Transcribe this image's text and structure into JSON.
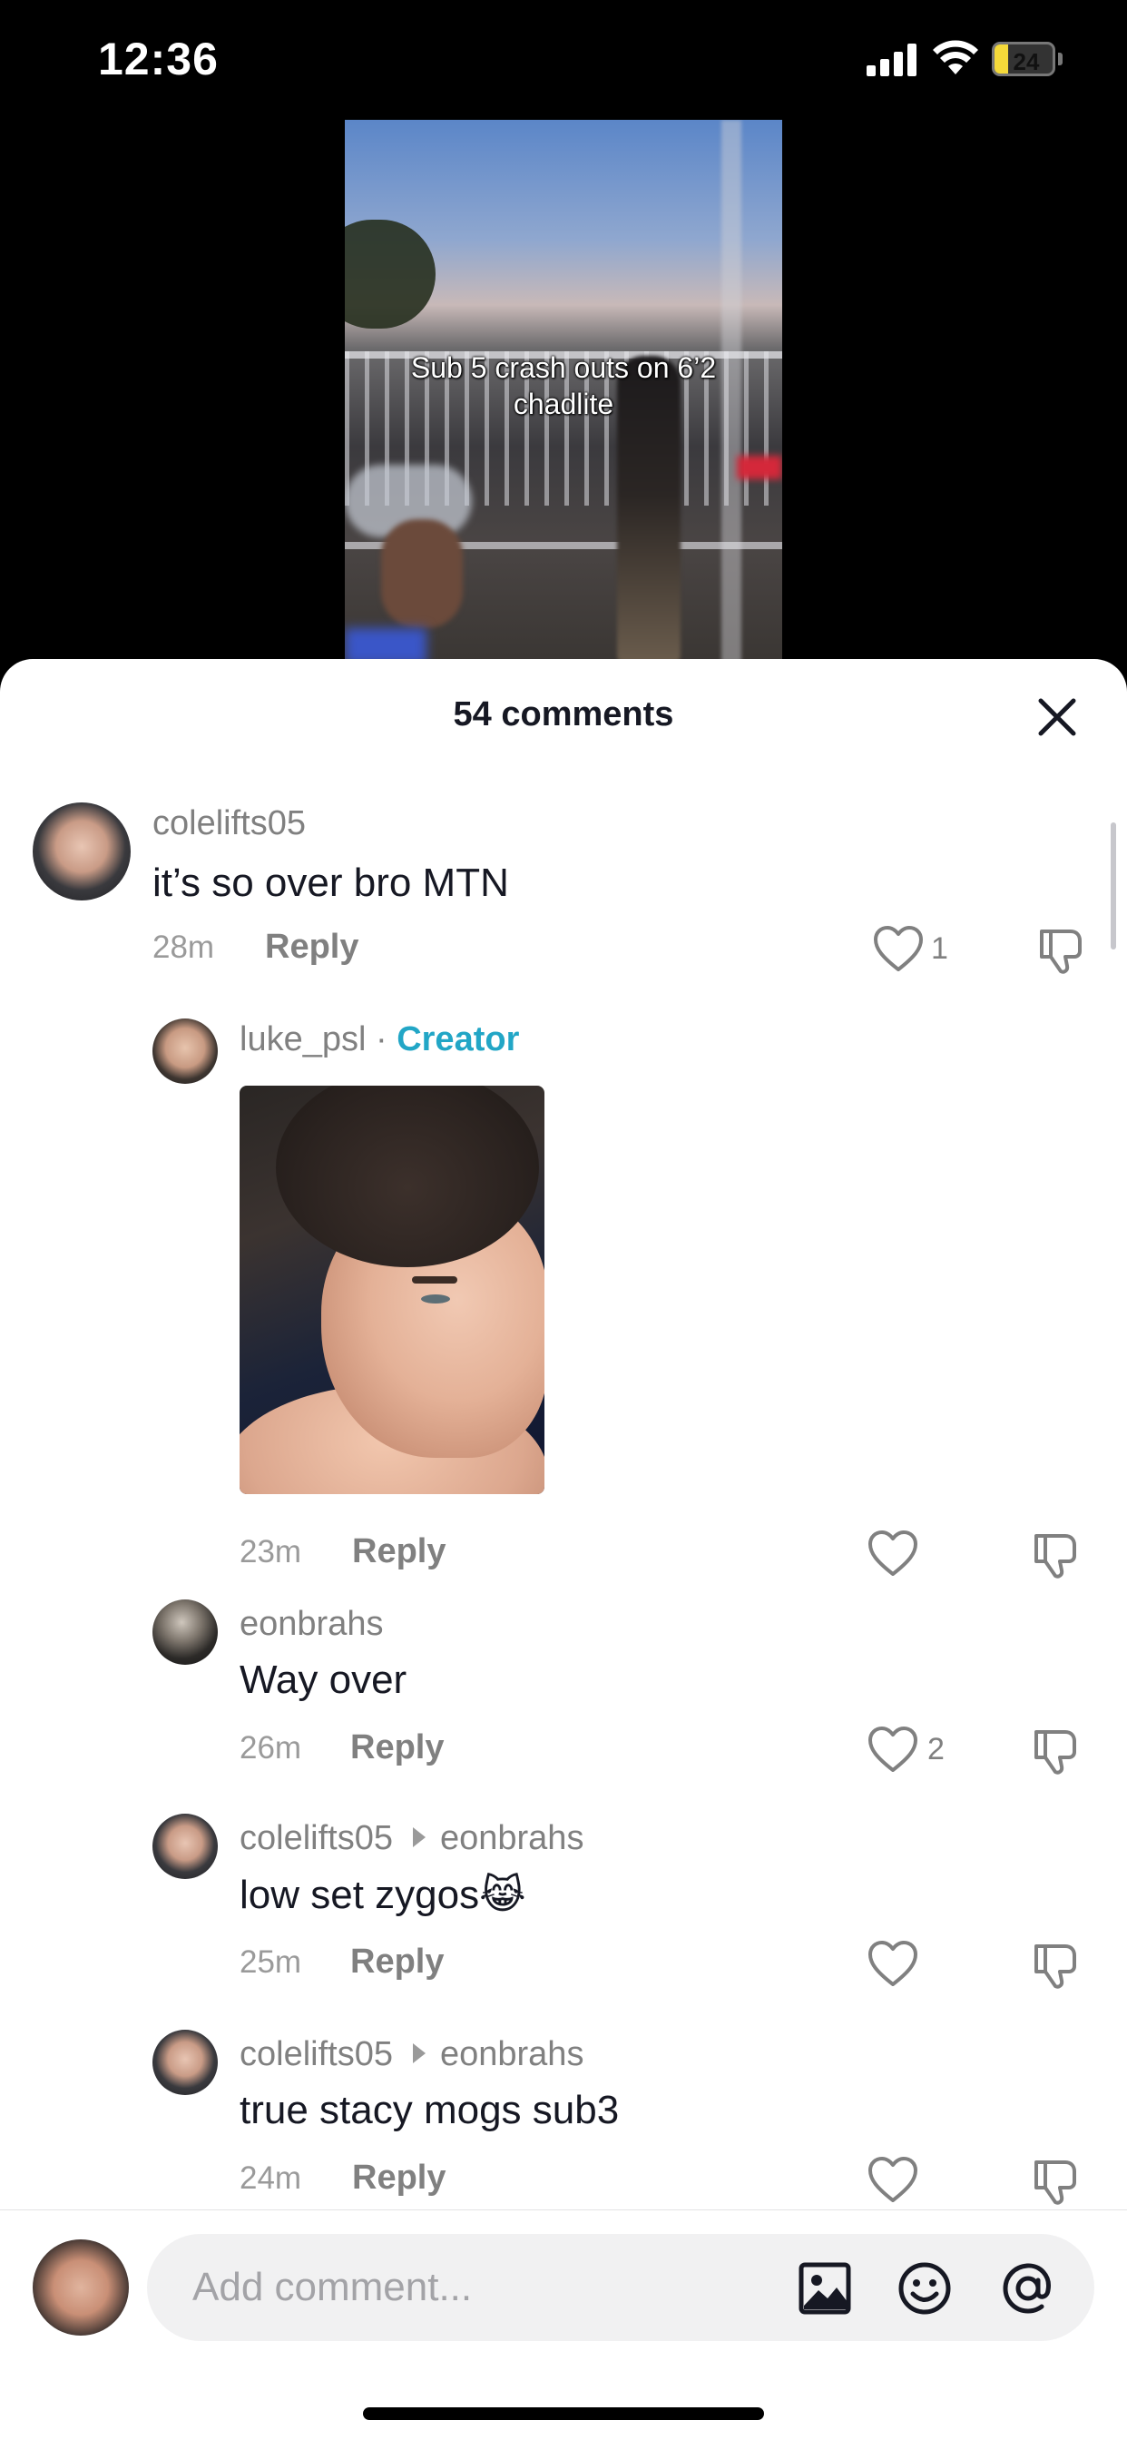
{
  "status_bar": {
    "time": "12:36",
    "battery": "24",
    "battery_level": 0.24,
    "battery_color": "#f4d93a"
  },
  "video": {
    "caption_line1": "Sub 5 crash outs on 6’2",
    "caption_line2": "chadlite"
  },
  "sheet": {
    "title": "54 comments",
    "close_icon": "close-icon"
  },
  "comments": [
    {
      "username": "colelifts05",
      "text": "it’s so over bro MTN",
      "time": "28m",
      "reply": "Reply",
      "likes": "1"
    },
    {
      "username": "luke_psl",
      "separator": " · ",
      "badge": "Creator",
      "time": "23m",
      "reply": "Reply",
      "likes": ""
    },
    {
      "username": "eonbrahs",
      "text": "Way over",
      "time": "26m",
      "reply": "Reply",
      "likes": "2"
    },
    {
      "username": "colelifts05",
      "reply_to": "eonbrahs",
      "text": "low set zygos😹",
      "time": "25m",
      "reply": "Reply",
      "likes": ""
    },
    {
      "username": "colelifts05",
      "reply_to": "eonbrahs",
      "text": "true stacy mogs sub3",
      "time": "24m",
      "reply": "Reply",
      "likes": ""
    }
  ],
  "composer": {
    "placeholder": "Add comment...",
    "icons": [
      "image-icon",
      "emoji-icon",
      "mention-icon"
    ]
  },
  "colors": {
    "creator_badge": "#22a6c6",
    "muted_text": "#808080",
    "primary_text": "#161823"
  }
}
